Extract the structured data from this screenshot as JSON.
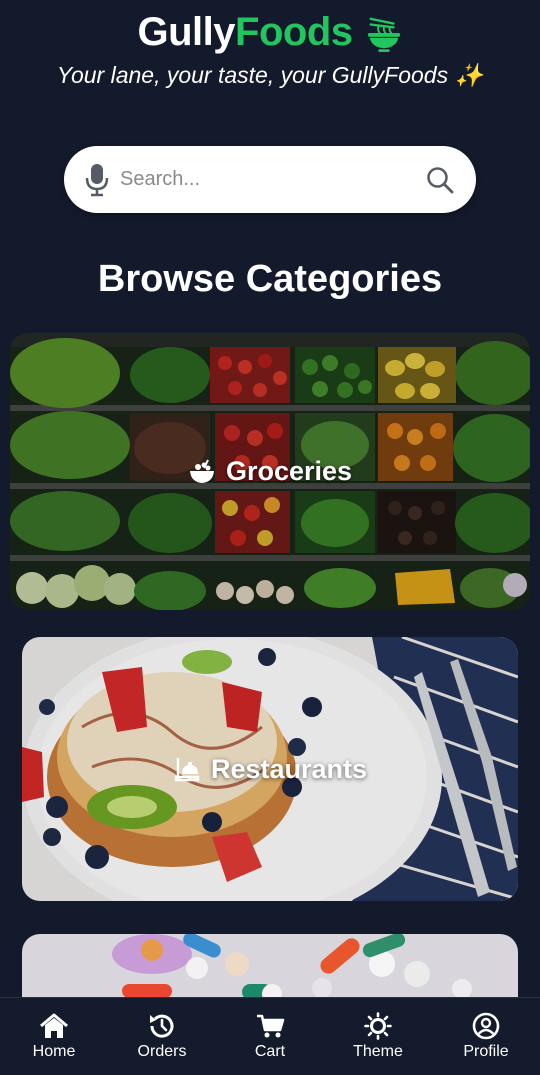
{
  "header": {
    "brand_part1": "Gully",
    "brand_part2": "Foods",
    "brand_icon": "noodle-bowl-icon",
    "tagline": "Your lane, your taste, your GullyFoods ✨",
    "brand_accent": "#22c55e"
  },
  "search": {
    "placeholder": "Search...",
    "value": "",
    "left_icon": "microphone-icon",
    "right_icon": "search-icon"
  },
  "browse": {
    "title": "Browse Categories",
    "categories": [
      {
        "label": "Groceries",
        "icon": "salad-bowl-icon"
      },
      {
        "label": "Restaurants",
        "icon": "chef-hat-icon"
      },
      {
        "label": "",
        "icon": "pills"
      }
    ]
  },
  "nav": {
    "items": [
      {
        "label": "Home",
        "icon": "home-icon"
      },
      {
        "label": "Orders",
        "icon": "history-icon"
      },
      {
        "label": "Cart",
        "icon": "cart-icon"
      },
      {
        "label": "Theme",
        "icon": "sun-icon"
      },
      {
        "label": "Profile",
        "icon": "user-circle-icon"
      }
    ]
  },
  "colors": {
    "background": "#131a2b",
    "nav_background": "#141b2d",
    "text": "#ffffff"
  }
}
